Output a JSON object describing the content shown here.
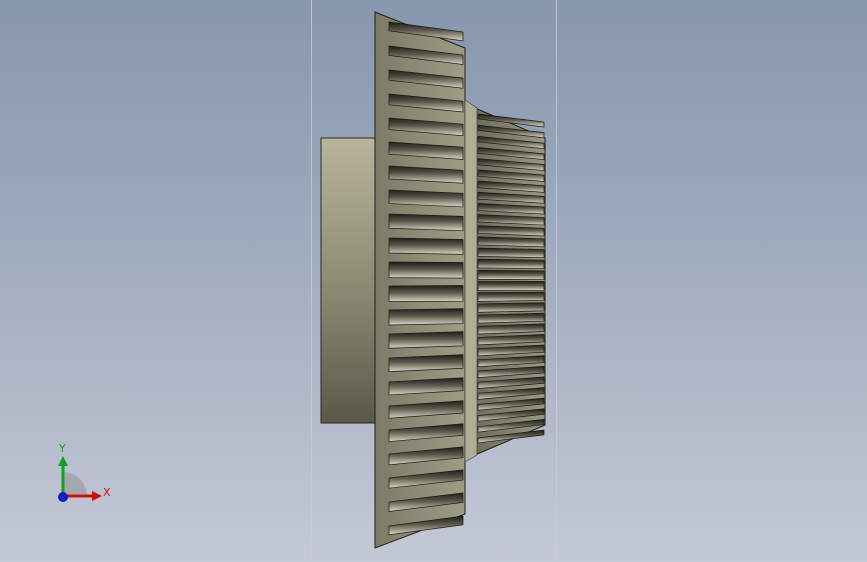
{
  "triad": {
    "x_label": "X",
    "y_label": "Y",
    "x_color": "#d01010",
    "y_color": "#10a020",
    "z_color": "#1020c0"
  },
  "model": {
    "part": "helical-gear",
    "face_color": "#8c8a74",
    "hub_color": "#9a977e",
    "slot_dark": "#2a2a24",
    "slot_light": "#d4d2c0"
  }
}
